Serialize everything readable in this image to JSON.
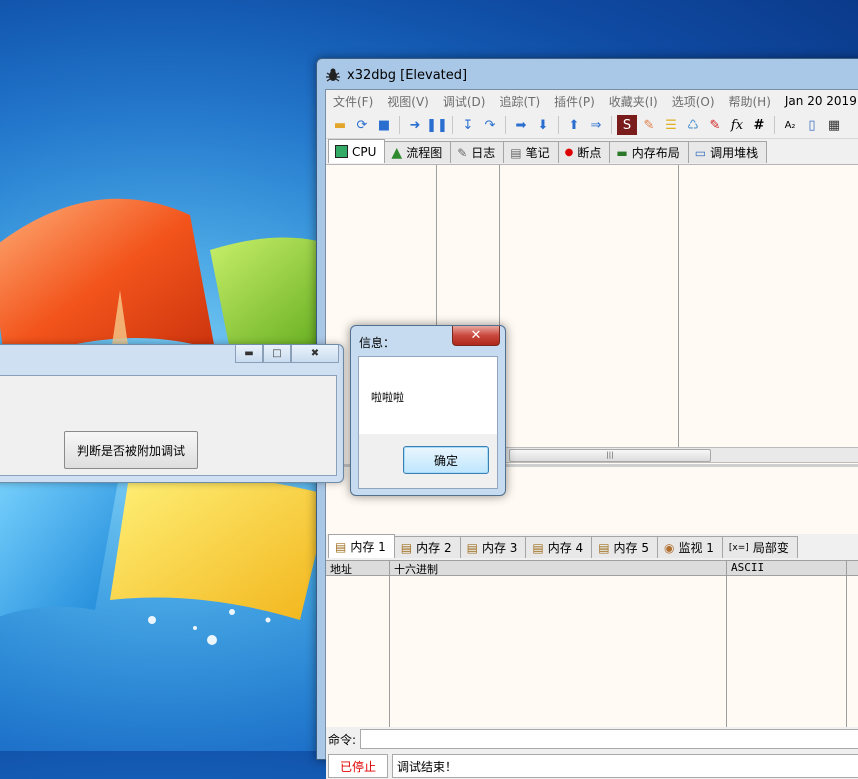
{
  "x32dbg": {
    "title": "x32dbg [Elevated]",
    "menu": [
      "文件(F)",
      "视图(V)",
      "调试(D)",
      "追踪(T)",
      "插件(P)",
      "收藏夹(I)",
      "选项(O)",
      "帮助(H)"
    ],
    "date": "Jan 20 2019",
    "tabs": [
      "CPU",
      "流程图",
      "日志",
      "笔记",
      "断点",
      "内存布局",
      "调用堆栈"
    ],
    "memory_tabs": [
      "内存 1",
      "内存 2",
      "内存 3",
      "内存 4",
      "内存 5",
      "监视 1",
      "局部变"
    ],
    "watch_prefix": "[x=]",
    "dump_headers": {
      "address": "地址",
      "hex": "十六进制",
      "ascii": "ASCII"
    },
    "command_label": "命令:",
    "status": "已停止",
    "status_message": "调试结束！",
    "colors": {
      "status": "#e00000"
    }
  },
  "app_window": {
    "button_label": "判断是否被附加调试"
  },
  "dialog": {
    "title": "信息：",
    "message": "啦啦啦",
    "ok_label": "确定"
  }
}
